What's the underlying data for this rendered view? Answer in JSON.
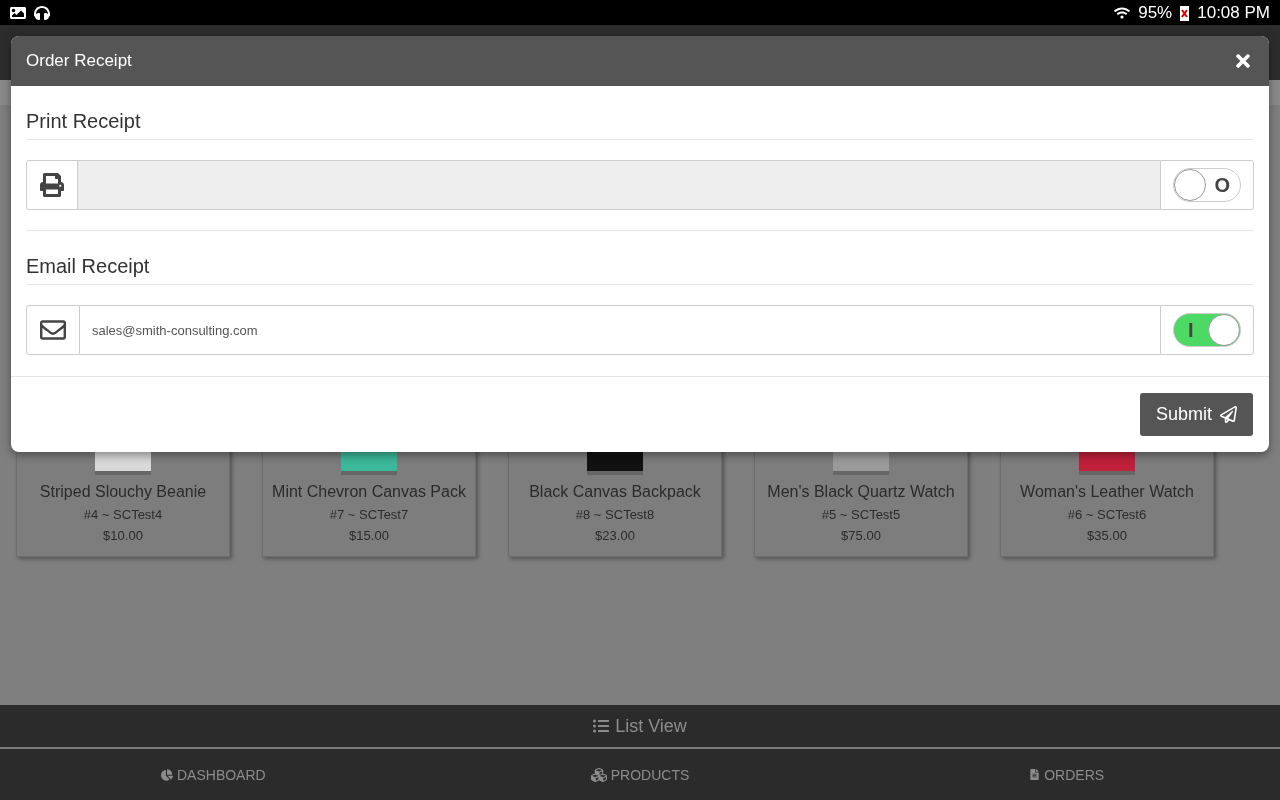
{
  "status_bar": {
    "battery": "95%",
    "time": "10:08 PM"
  },
  "products": [
    {
      "name": "Striped Slouchy Beanie",
      "sku": "#4 ~ SCTest4",
      "price": "$10.00",
      "color": "#d9d9d9"
    },
    {
      "name": "Mint Chevron Canvas Pack",
      "sku": "#7 ~ SCTest7",
      "price": "$15.00",
      "color": "#3cb89a"
    },
    {
      "name": "Black Canvas Backpack",
      "sku": "#8 ~ SCTest8",
      "price": "$23.00",
      "color": "#111111"
    },
    {
      "name": "Men's Black Quartz Watch",
      "sku": "#5 ~ SCTest5",
      "price": "$75.00",
      "color": "#9a9a9a"
    },
    {
      "name": "Woman's Leather Watch",
      "sku": "#6 ~ SCTest6",
      "price": "$35.00",
      "color": "#c0203a"
    }
  ],
  "view_toggle": {
    "label": "List View"
  },
  "nav": [
    {
      "label": "DASHBOARD",
      "kind": "dashboard"
    },
    {
      "label": "PRODUCTS",
      "kind": "products"
    },
    {
      "label": "ORDERS",
      "kind": "orders"
    }
  ],
  "modal": {
    "title": "Order Receipt",
    "sections": [
      {
        "heading": "Print Receipt",
        "kind": "print",
        "disabled": true,
        "toggle": {
          "on": false,
          "label": "O"
        }
      },
      {
        "heading": "Email Receipt",
        "kind": "email",
        "value": "sales@smith-consulting.com",
        "disabled": false,
        "toggle": {
          "on": true,
          "label": "I"
        }
      }
    ],
    "submit": "Submit"
  }
}
